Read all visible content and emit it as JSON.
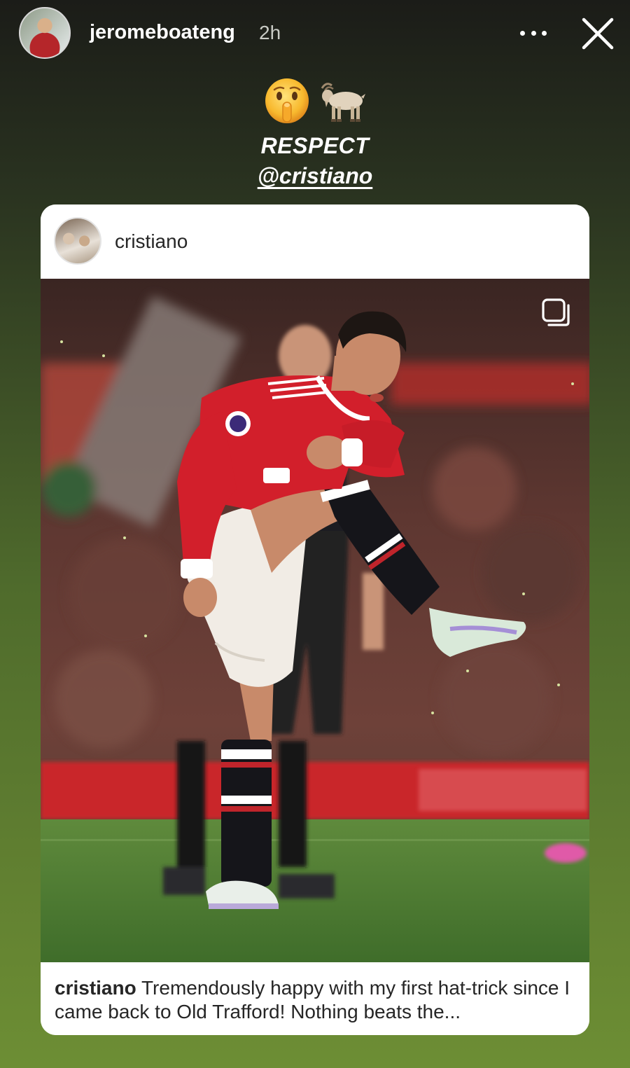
{
  "story": {
    "username": "jeromeboateng",
    "timestamp": "2h",
    "emojis": [
      "🤫",
      "🐐"
    ],
    "headline": "RESPECT",
    "mention": "@cristiano"
  },
  "post": {
    "username": "cristiano",
    "caption_username": "cristiano",
    "caption_text": "Tremendously happy with my first hat-trick since I came back to Old Trafford! Nothing beats the..."
  },
  "icons": {
    "more": "more-options-icon",
    "close": "close-icon",
    "carousel": "carousel-icon"
  },
  "colors": {
    "background_top": "#1b1c18",
    "background_bottom": "#6d8e34",
    "card": "#ffffff",
    "jersey_red": "#d21f2b"
  }
}
